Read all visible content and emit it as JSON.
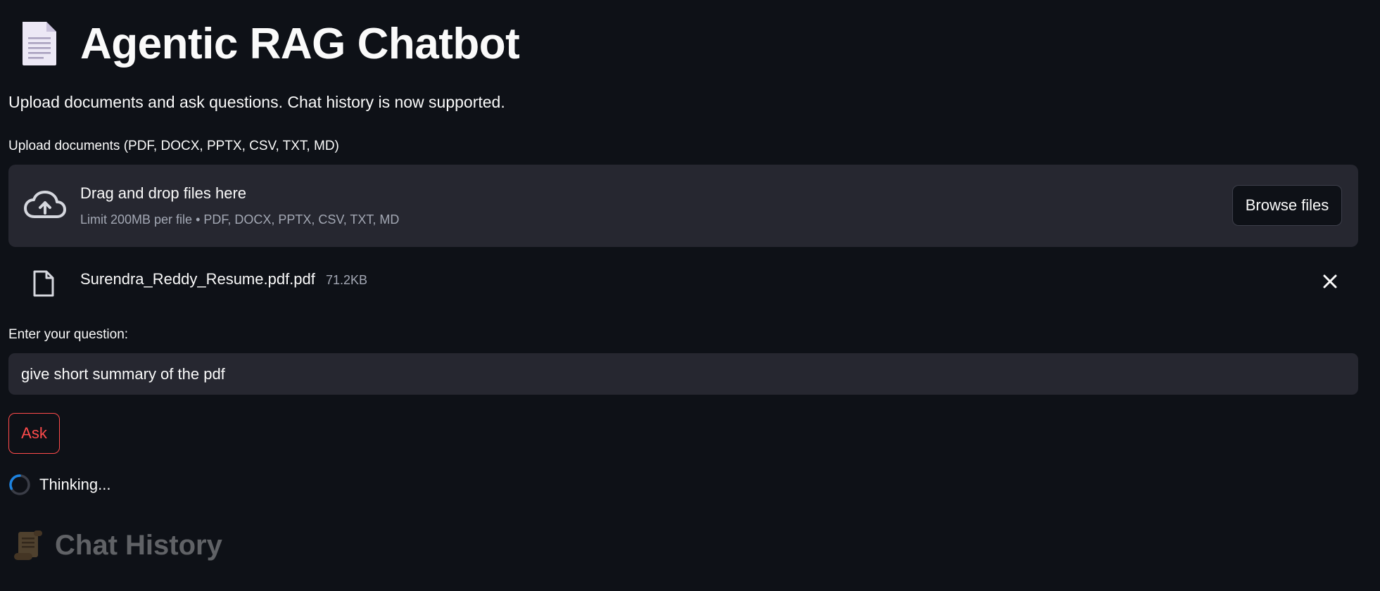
{
  "header": {
    "title": "Agentic RAG Chatbot",
    "title_icon": "document-icon",
    "subtitle": "Upload documents and ask questions. Chat history is now supported."
  },
  "uploader": {
    "label": "Upload documents (PDF, DOCX, PPTX, CSV, TXT, MD)",
    "drop_title": "Drag and drop files here",
    "drop_subtitle": "Limit 200MB per file • PDF, DOCX, PPTX, CSV, TXT, MD",
    "browse_label": "Browse files",
    "icon": "cloud-upload-icon"
  },
  "uploaded_files": [
    {
      "name": "Surendra_Reddy_Resume.pdf.pdf",
      "size": "71.2KB",
      "icon": "file-icon"
    }
  ],
  "question": {
    "label": "Enter your question:",
    "value": "give short summary of the pdf"
  },
  "ask_button": {
    "label": "Ask"
  },
  "status": {
    "text": "Thinking..."
  },
  "chat_history": {
    "title": "Chat History",
    "icon": "scroll-icon"
  },
  "colors": {
    "background": "#0e1117",
    "surface": "#262730",
    "text": "#fafafa",
    "muted_text": "#a3a8b4",
    "primary": "#ff4b4b",
    "spinner": "#1c83e1"
  }
}
